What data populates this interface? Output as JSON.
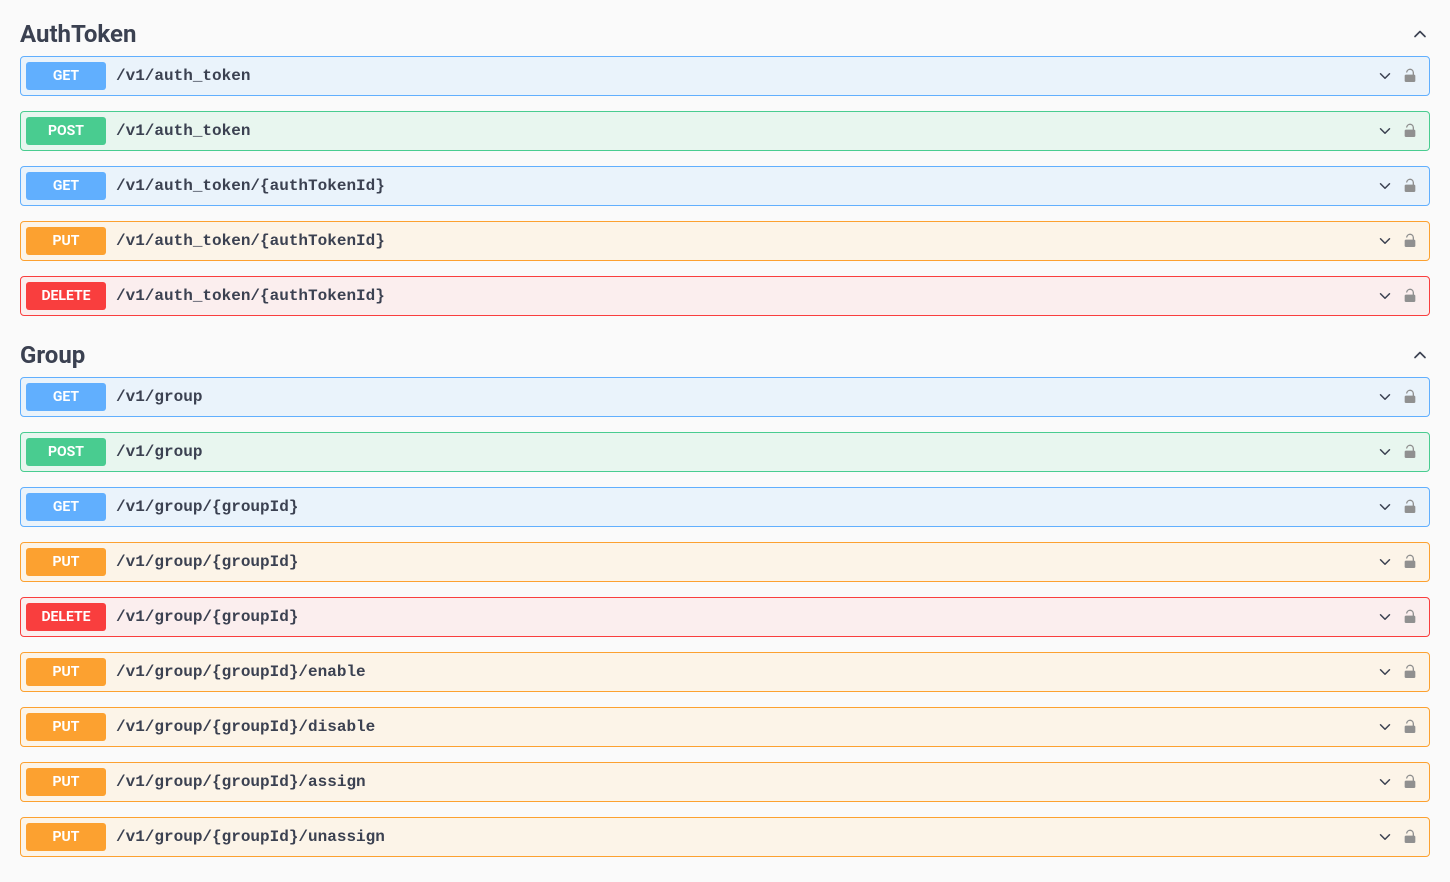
{
  "colors": {
    "get": "#61affe",
    "post": "#49cc90",
    "put": "#fca130",
    "delete": "#f93e3e"
  },
  "sections": [
    {
      "title": "AuthToken",
      "expanded": true,
      "operations": [
        {
          "method": "GET",
          "label": "GET",
          "path": "/v1/auth_token",
          "locked": true
        },
        {
          "method": "POST",
          "label": "POST",
          "path": "/v1/auth_token",
          "locked": true
        },
        {
          "method": "GET",
          "label": "GET",
          "path": "/v1/auth_token/{authTokenId}",
          "locked": true
        },
        {
          "method": "PUT",
          "label": "PUT",
          "path": "/v1/auth_token/{authTokenId}",
          "locked": true
        },
        {
          "method": "DELETE",
          "label": "DELETE",
          "path": "/v1/auth_token/{authTokenId}",
          "locked": true
        }
      ]
    },
    {
      "title": "Group",
      "expanded": true,
      "operations": [
        {
          "method": "GET",
          "label": "GET",
          "path": "/v1/group",
          "locked": true
        },
        {
          "method": "POST",
          "label": "POST",
          "path": "/v1/group",
          "locked": true
        },
        {
          "method": "GET",
          "label": "GET",
          "path": "/v1/group/{groupId}",
          "locked": true
        },
        {
          "method": "PUT",
          "label": "PUT",
          "path": "/v1/group/{groupId}",
          "locked": true
        },
        {
          "method": "DELETE",
          "label": "DELETE",
          "path": "/v1/group/{groupId}",
          "locked": true
        },
        {
          "method": "PUT",
          "label": "PUT",
          "path": "/v1/group/{groupId}/enable",
          "locked": true
        },
        {
          "method": "PUT",
          "label": "PUT",
          "path": "/v1/group/{groupId}/disable",
          "locked": true
        },
        {
          "method": "PUT",
          "label": "PUT",
          "path": "/v1/group/{groupId}/assign",
          "locked": true
        },
        {
          "method": "PUT",
          "label": "PUT",
          "path": "/v1/group/{groupId}/unassign",
          "locked": true
        }
      ]
    }
  ]
}
